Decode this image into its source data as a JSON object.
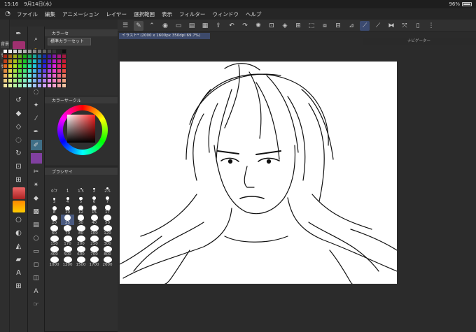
{
  "status_bar": {
    "time": "15:16",
    "date": "9月14日(水)",
    "battery": "96%"
  },
  "menu": {
    "items": [
      "ファイル",
      "編集",
      "アニメーション",
      "レイヤー",
      "選択範囲",
      "表示",
      "フィルター",
      "ウィンドウ",
      "ヘルプ"
    ]
  },
  "left_strip": {
    "labels": [
      "背景",
      "セット1",
      "セット"
    ]
  },
  "color_set": {
    "title": "カラーセ",
    "dropdown": "標準カラーセット"
  },
  "color_circle": {
    "title": "カラーサークル"
  },
  "brush_size": {
    "title": "ブラシサイ",
    "sizes": [
      "0.7",
      "1",
      "1.5",
      "2",
      "2.5",
      "3",
      "4",
      "5",
      "6",
      "7",
      "8",
      "10",
      "12",
      "15",
      "17",
      "20",
      "25",
      "30",
      "40",
      "50",
      "60",
      "70",
      "80",
      "100",
      "120",
      "150",
      "170",
      "200",
      "250",
      "300",
      "400",
      "500",
      "600",
      "700",
      "800",
      "1000",
      "1200",
      "1500",
      "1700",
      "2000"
    ],
    "selected": "25"
  },
  "document": {
    "tab": "イラスト* (2000 x 1600px 350dpi 69.7%)"
  },
  "navigator": {
    "title": "ナビゲーター"
  },
  "colors": {
    "accent": "#4a5a80",
    "panel": "#2f2f2f",
    "canvas": "#ffffff"
  }
}
